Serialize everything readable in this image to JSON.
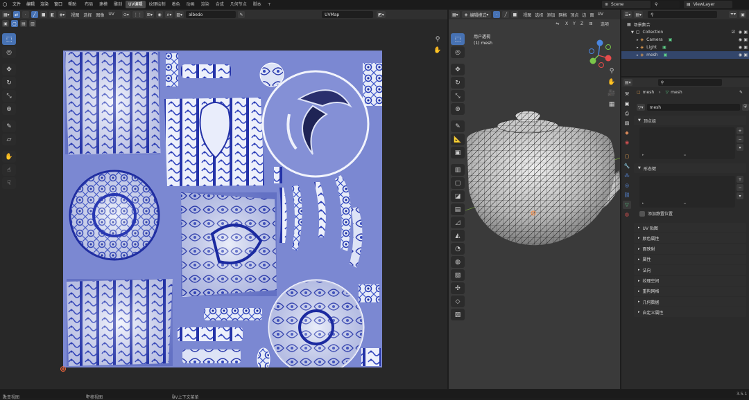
{
  "topbar": {
    "menus": [
      "文件",
      "编辑",
      "渲染",
      "窗口",
      "帮助"
    ],
    "workspaces": [
      "布局",
      "建模",
      "雕刻",
      "UV编辑",
      "纹理绘制",
      "着色",
      "动画",
      "渲染",
      "合成",
      "几何节点",
      "脚本",
      "+"
    ],
    "active_workspace_index": 3,
    "scene": "Scene",
    "view_layer": "ViewLayer"
  },
  "uv_editor": {
    "header": {
      "view_menus": [
        "视图",
        "选择",
        "图像",
        "UV"
      ],
      "image_name": "albedo",
      "uv_map": "UVMap"
    },
    "cursor_icon": "uv-cursor-icon"
  },
  "viewport": {
    "header": {
      "mode": "编辑模式",
      "menus": [
        "视图",
        "选择",
        "添加",
        "网格",
        "顶点",
        "边",
        "面",
        "UV"
      ],
      "axes": [
        "X",
        "Y",
        "Z"
      ],
      "options": "选项"
    },
    "overlay_title": "用户透视",
    "overlay_object": "(1) mesh",
    "gizmo_axes": [
      "X",
      "Y",
      "Z"
    ]
  },
  "outliner": {
    "root": "场景集合",
    "collection": "Collection",
    "items": [
      {
        "label": "Camera",
        "color": "#e8a050"
      },
      {
        "label": "Light",
        "color": "#e8a050"
      },
      {
        "label": "mesh",
        "color": "#e8a050",
        "selected": true
      }
    ]
  },
  "properties": {
    "breadcrumb_object": "mesh",
    "breadcrumb_data": "mesh",
    "data_name": "mesh",
    "sections": {
      "vertex_groups": "顶点组",
      "shape_keys": "形态键",
      "add_rest_position": "添加静置位置",
      "collapsed": [
        "UV 贴图",
        "颜色属性",
        "面映射",
        "属性",
        "法向",
        "纹理空间",
        "重构网格",
        "几何数据",
        "自定义属性"
      ]
    }
  },
  "statusbar": {
    "left": "改变视图",
    "mid1": "平移视图",
    "mid2": "UV上下文菜单",
    "version": "3.5.1"
  }
}
